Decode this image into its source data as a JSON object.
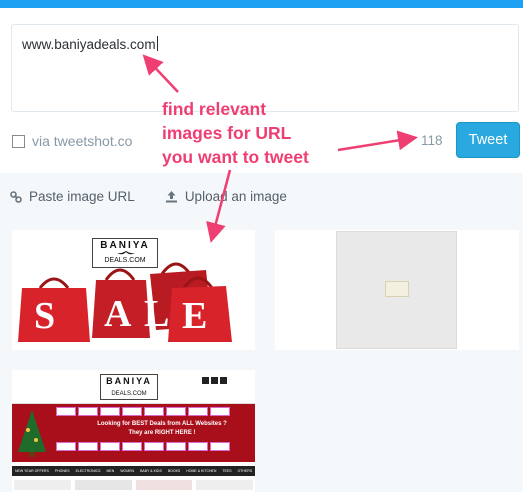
{
  "composer": {
    "tweet_text": "www.baniyadeals.com",
    "via_label": "via tweetshot.co",
    "char_counter": "118",
    "tweet_button_label": "Tweet"
  },
  "actions": {
    "paste_image_url_label": "Paste image URL",
    "upload_image_label": "Upload an image"
  },
  "annotation": {
    "lines": [
      "find relevant",
      "images for URL",
      "you want to tweet"
    ]
  },
  "image_cards": {
    "sale": {
      "logo_line1": "BANIYA",
      "logo_line2": "DEALS.COM",
      "sale_letters": [
        "S",
        "A",
        "L",
        "E"
      ]
    },
    "site": {
      "logo_line1": "BANIYA",
      "logo_line2": "DEALS.COM",
      "banner_line1": "Looking for BEST Deals from ALL Websites ?",
      "banner_line2": "They are RIGHT HERE !",
      "nav_items": [
        "NEW YEAR OFFERS",
        "PHONES",
        "ELECTRONICS",
        "MEN",
        "WOMEN",
        "BABY & KIDS",
        "BOOKS",
        "HOME & KITCHEN",
        "TEES",
        "OTHERS"
      ]
    }
  },
  "colors": {
    "accent": "#1da1f2",
    "tweet_button": "#2aa9e0",
    "annotation": "#ef3e71",
    "bag_red": "#d8232a"
  }
}
